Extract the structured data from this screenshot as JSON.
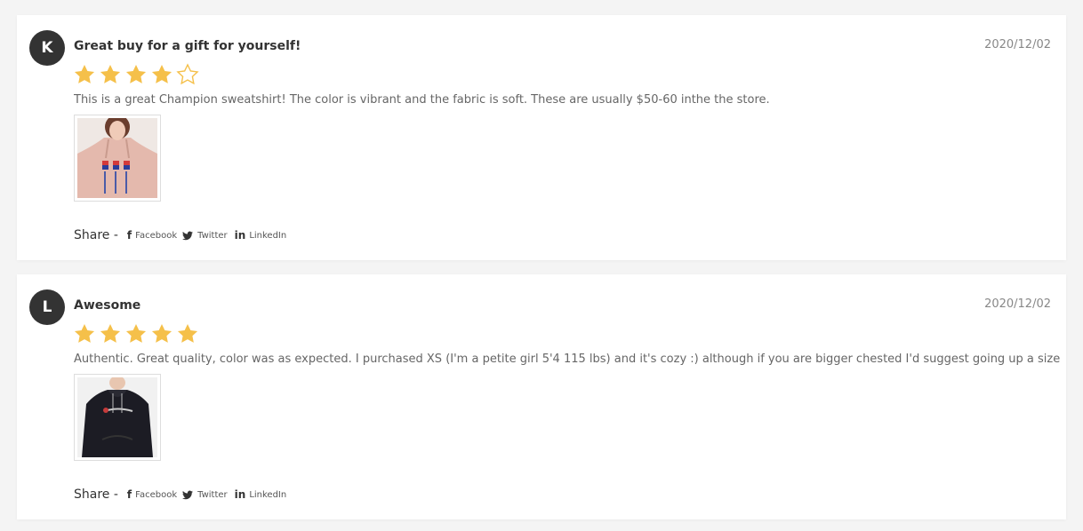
{
  "reviews": [
    {
      "initial": "K",
      "title": "Great buy for a gift for yourself!",
      "date": "2020/12/02",
      "rating": 4,
      "max_rating": 5,
      "text": "This is a great Champion sweatshirt! The color is vibrant and the fabric is soft. These are usually $50-60 inthe the store.",
      "photo_icon": "pink-champion-hoodie-photo"
    },
    {
      "initial": "L",
      "title": "Awesome",
      "date": "2020/12/02",
      "rating": 5,
      "max_rating": 5,
      "text": "Authentic. Great quality, color was as expected. I purchased XS (I'm a petite girl 5'4 115 lbs) and it's cozy :) although if you are bigger chested I'd suggest going up a size",
      "photo_icon": "black-champion-hoodie-photo"
    }
  ],
  "share": {
    "label": "Share -",
    "facebook": "Facebook",
    "twitter": "Twitter",
    "linkedin": "LinkedIn"
  },
  "colors": {
    "star": "#f5c04a",
    "avatar": "#333333"
  }
}
